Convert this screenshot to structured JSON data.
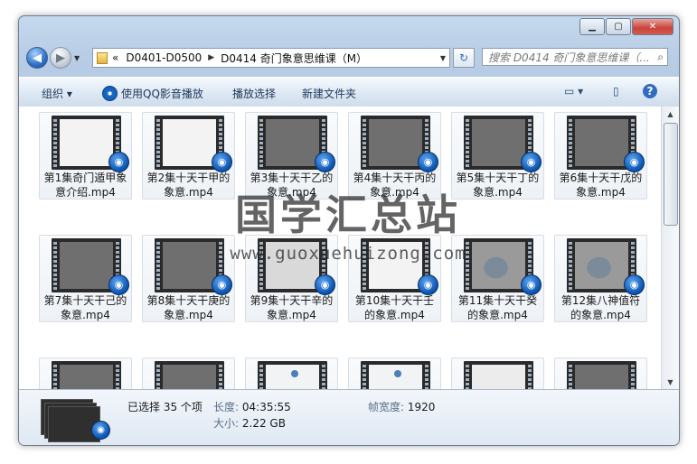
{
  "window": {
    "minimize": "▁",
    "maximize": "▢",
    "close": "✕"
  },
  "address": {
    "chevrons": "«",
    "crumb1": "D0401-D0500",
    "sep": "▶",
    "crumb2": "D0414 奇门象意思维课（M）"
  },
  "search": {
    "placeholder": "搜索 D0414 奇门象意思维课（..."
  },
  "toolbar": {
    "organize": "组织 ▾",
    "qq_play": "使用QQ影音播放",
    "play_select": "播放选择",
    "new_folder": "新建文件夹",
    "view_icon": "▭ ▾",
    "pane_icon": "▯",
    "help_icon": "?"
  },
  "files": [
    {
      "line1": "第1集奇门遁甲象",
      "line2": "意介绍.mp4",
      "thumb": "white"
    },
    {
      "line1": "第2集十天干甲的",
      "line2": "象意.mp4",
      "thumb": "white"
    },
    {
      "line1": "第3集十天干乙的",
      "line2": "象意.mp4",
      "thumb": "dark"
    },
    {
      "line1": "第4集十天干丙的",
      "line2": "象意.mp4",
      "thumb": "dark"
    },
    {
      "line1": "第5集十天干丁的",
      "line2": "象意.mp4",
      "thumb": "dark"
    },
    {
      "line1": "第6集十天干戊的",
      "line2": "象意.mp4",
      "thumb": "dark"
    },
    {
      "line1": "第7集十天干己的",
      "line2": "象意.mp4",
      "thumb": "dark"
    },
    {
      "line1": "第8集十天干庚的",
      "line2": "象意.mp4",
      "thumb": "dark"
    },
    {
      "line1": "第9集十天干辛的",
      "line2": "象意.mp4",
      "thumb": "light"
    },
    {
      "line1": "第10集十天干壬",
      "line2": "的象意.mp4",
      "thumb": "white"
    },
    {
      "line1": "第11集十天干癸",
      "line2": "的象意.mp4",
      "thumb": "person"
    },
    {
      "line1": "第12集八神值符",
      "line2": "的象意.mp4",
      "thumb": "person"
    },
    {
      "line1": "",
      "line2": "",
      "thumb": "dark"
    },
    {
      "line1": "",
      "line2": "",
      "thumb": "dark"
    },
    {
      "line1": "",
      "line2": "",
      "thumb": "slide"
    },
    {
      "line1": "",
      "line2": "",
      "thumb": "slide"
    },
    {
      "line1": "",
      "line2": "",
      "thumb": "faint"
    },
    {
      "line1": "",
      "line2": "",
      "thumb": "dark"
    }
  ],
  "details": {
    "selected": "已选择 35 个项",
    "length_key": "长度:",
    "length_val": "04:35:55",
    "width_key": "帧宽度:",
    "width_val": "1920",
    "size_key": "大小:",
    "size_val": "2.22 GB"
  },
  "watermark": {
    "text": "国学汇总站",
    "url": "www.guoxuehuizong.com"
  },
  "icons": {
    "back": "◀",
    "forward": "▶",
    "refresh": "↻",
    "search": "⌕",
    "media_badge": "◉"
  }
}
